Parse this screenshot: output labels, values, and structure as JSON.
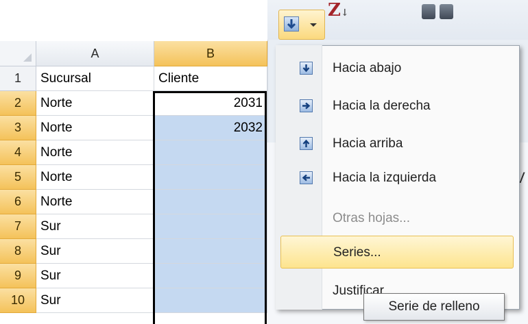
{
  "sheet": {
    "columns": [
      "A",
      "B"
    ],
    "rows": [
      {
        "num": "1",
        "a": "Sucursal",
        "b": "Cliente"
      },
      {
        "num": "2",
        "a": "Norte",
        "b": "2031"
      },
      {
        "num": "3",
        "a": "Norte",
        "b": "2032"
      },
      {
        "num": "4",
        "a": "Norte",
        "b": ""
      },
      {
        "num": "5",
        "a": "Norte",
        "b": ""
      },
      {
        "num": "6",
        "a": "Norte",
        "b": ""
      },
      {
        "num": "7",
        "a": "Sur",
        "b": ""
      },
      {
        "num": "8",
        "a": "Sur",
        "b": ""
      },
      {
        "num": "9",
        "a": "Sur",
        "b": ""
      },
      {
        "num": "10",
        "a": "Sur",
        "b": ""
      }
    ]
  },
  "ribbon": {
    "sort_icon": "sort-az-icon",
    "find_icon": "binoculars-icon",
    "right_fragment": "V"
  },
  "fill_menu": {
    "items": [
      {
        "label": "Hacia abajo",
        "icon": "fill-down-icon",
        "enabled": true
      },
      {
        "label": "Hacia la derecha",
        "icon": "fill-right-icon",
        "enabled": true
      },
      {
        "label": "Hacia arriba",
        "icon": "fill-up-icon",
        "enabled": true
      },
      {
        "label": "Hacia la izquierda",
        "icon": "fill-left-icon",
        "enabled": true
      },
      {
        "label": "Otras hojas...",
        "icon": "",
        "enabled": false
      },
      {
        "label": "Series...",
        "icon": "",
        "enabled": true,
        "highlighted": true
      },
      {
        "label": "Justificar",
        "icon": "",
        "enabled": true
      }
    ],
    "tooltip": "Serie de relleno"
  },
  "colors": {
    "selection_blue": "#c5d9f1",
    "header_selected": "#f4c25a",
    "menu_highlight": "#fde48e"
  }
}
